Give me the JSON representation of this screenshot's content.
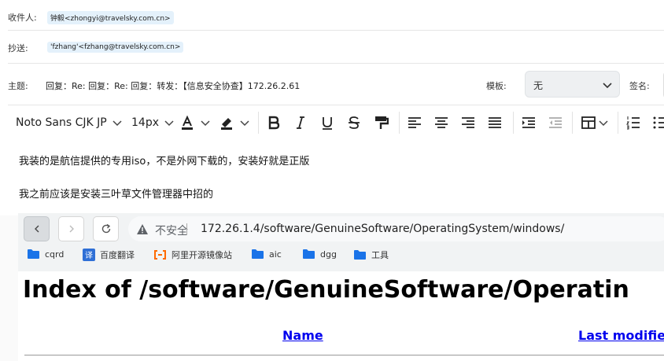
{
  "header": {
    "to_label": "收件人:",
    "to_value": "钟毅<zhongyi@travelsky.com.cn>",
    "cc_label": "抄送:",
    "cc_value": "'fzhang'<fzhang@travelsky.com.cn>",
    "subject_label": "主题:",
    "subject_value": "回复：Re: 回复：Re: 回复：转发：【信息安全协查】172.26.2.61",
    "template_label": "模板:",
    "template_value": "无",
    "sign_label": "签名:"
  },
  "toolbar": {
    "font_family": "Noto Sans CJK JP",
    "font_size": "14px",
    "icons": [
      "font-color-icon",
      "highlight-icon",
      "bold-icon",
      "italic-icon",
      "underline-icon",
      "strikethrough-icon",
      "format-painter-icon",
      "align-left-icon",
      "align-center-icon",
      "align-right-icon",
      "justify-icon",
      "indent-icon",
      "outdent-icon",
      "table-icon",
      "ordered-list-icon",
      "bullet-list-icon"
    ]
  },
  "body": {
    "line1": "我装的是航信提供的专用iso，不是外网下载的，安装好就是正版",
    "line2": "我之前应该是安装三叶草文件管理器中招的"
  },
  "browser": {
    "security_label": "不安全",
    "address": "172.26.1.4/software/GenuineSoftware/OperatingSystem/windows/",
    "bookmarks": [
      {
        "label": "cqrd",
        "icon": "folder-icon"
      },
      {
        "label": "百度翻译",
        "icon": "translate-icon"
      },
      {
        "label": "阿里开源镜像站",
        "icon": "aliyun-icon"
      },
      {
        "label": "aic",
        "icon": "folder-icon"
      },
      {
        "label": "dgg",
        "icon": "folder-icon"
      },
      {
        "label": "工具",
        "icon": "folder-icon"
      }
    ],
    "page_title": "Index of /software/GenuineSoftware/Operatin",
    "col_name": "Name",
    "col_modified": "Last modifie"
  },
  "colors": {
    "chip_bg": "#e4f1fb",
    "link": "#0000ee",
    "folder": "#1a73e8"
  }
}
